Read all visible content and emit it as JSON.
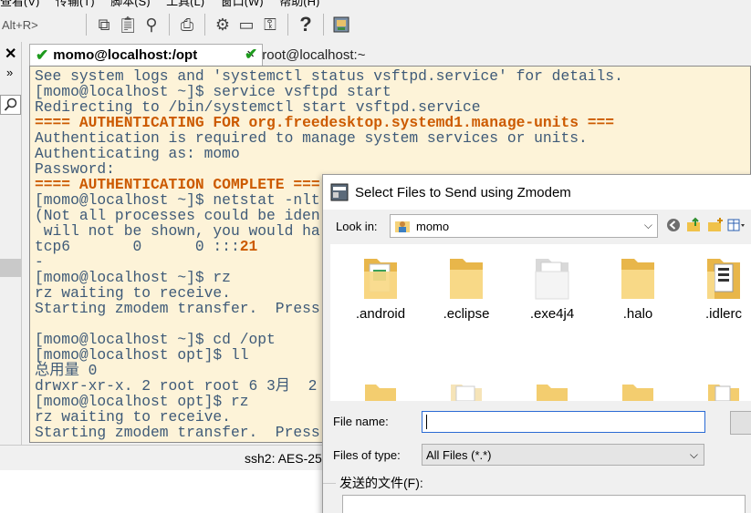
{
  "menubar": {
    "items": [
      "查看(V)",
      "传输(T)",
      "脚本(S)",
      "工具(L)",
      "窗口(W)",
      "帮助(H)"
    ]
  },
  "toolbar": {
    "shortcut": "Alt+R>"
  },
  "tabs": [
    {
      "label": "momo@localhost:/opt"
    },
    {
      "label": "root@localhost:~"
    }
  ],
  "tab_close": "×",
  "terminal": {
    "lines": [
      {
        "t": "See system logs and 'systemctl status vsftpd.service' for details."
      },
      {
        "t": "[momo@localhost ~]$ service vsftpd start"
      },
      {
        "t": "Redirecting to /bin/systemctl start vsftpd.service"
      },
      {
        "t": "==== AUTHENTICATING FOR org.freedesktop.systemd1.manage-units ===",
        "warn": true
      },
      {
        "t": "Authentication is required to manage system services or units."
      },
      {
        "t": "Authenticating as: momo"
      },
      {
        "t": "Password:"
      },
      {
        "t": "==== AUTHENTICATION COMPLETE ===",
        "warn": true
      },
      {
        "t": "[momo@localhost ~]$ netstat -nlt"
      },
      {
        "t": "(Not all processes could be iden"
      },
      {
        "t": " will not be shown, you would ha"
      },
      {
        "t": "tcp6       0      0 :::",
        "hl": "21"
      },
      {
        "t": "-"
      },
      {
        "t": "[momo@localhost ~]$ rz"
      },
      {
        "t": "rz waiting to receive."
      },
      {
        "t": "Starting zmodem transfer.  Press"
      },
      {
        "t": ""
      },
      {
        "t": "[momo@localhost ~]$ cd /opt"
      },
      {
        "t": "[momo@localhost opt]$ ll"
      },
      {
        "t": "总用量 0"
      },
      {
        "t": "drwxr-xr-x. 2 root root 6 3月  2"
      },
      {
        "t": "[momo@localhost opt]$ rz"
      },
      {
        "t": "rz waiting to receive."
      },
      {
        "t": "Starting zmodem transfer.  Press"
      }
    ]
  },
  "statusbar": {
    "text": "ssh2: AES-25"
  },
  "dialog": {
    "title": "Select Files to Send using Zmodem",
    "look_in_label": "Look in:",
    "look_in_value": "momo",
    "files": [
      ".android",
      ".eclipse",
      ".exe4j4",
      ".halo",
      ".idlerc"
    ],
    "file_name_label": "File name:",
    "file_name_value": "",
    "file_type_label": "Files of type:",
    "file_type_value": "All Files (*.*)",
    "sent_files_label": "发送的文件(F):"
  },
  "colors": {
    "terminal_bg": "#fdf3d8",
    "terminal_text": "#3e5a78",
    "terminal_warn": "#cc5a00",
    "tab_check": "#1d9a1d",
    "folder": "#f5d27a"
  }
}
